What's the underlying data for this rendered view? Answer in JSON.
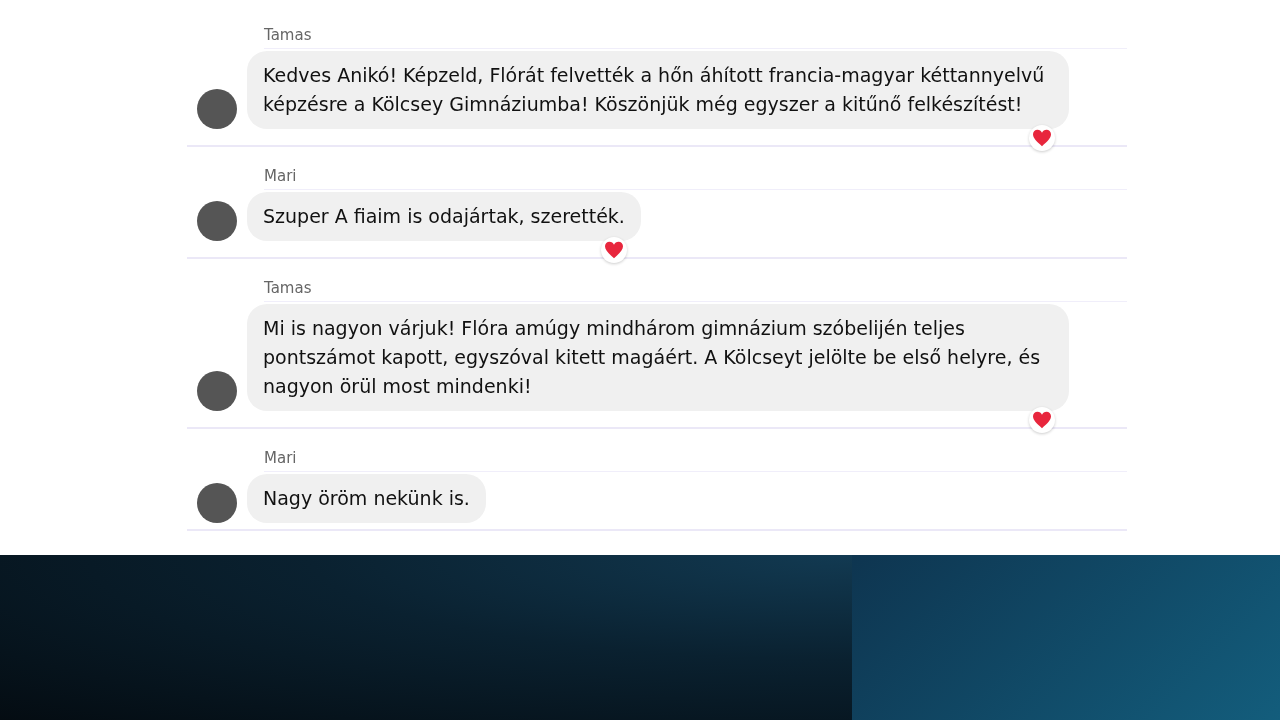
{
  "messages": [
    {
      "author": "Tamas",
      "text": "Kedves Anikó! Képzeld, Flórát felvették a hőn áhított francia-magyar kéttannyelvű képzésre a Kölcsey Gimnáziumba! Köszönjük még egyszer a kitűnő felkészítést!",
      "heart": true
    },
    {
      "author": "Mari",
      "text": "Szuper A fiaim is odajártak, szerették.",
      "heart": true
    },
    {
      "author": "Tamas",
      "text": "Mi is nagyon várjuk! Flóra amúgy mindhárom gimnázium szóbelijén teljes pontszámot kapott, egyszóval kitett magáért. A Kölcseyt jelölte be első helyre, és nagyon örül most mindenki!",
      "heart": true
    },
    {
      "author": "Mari",
      "text": "Nagy öröm nekünk is.",
      "heart": false
    }
  ]
}
